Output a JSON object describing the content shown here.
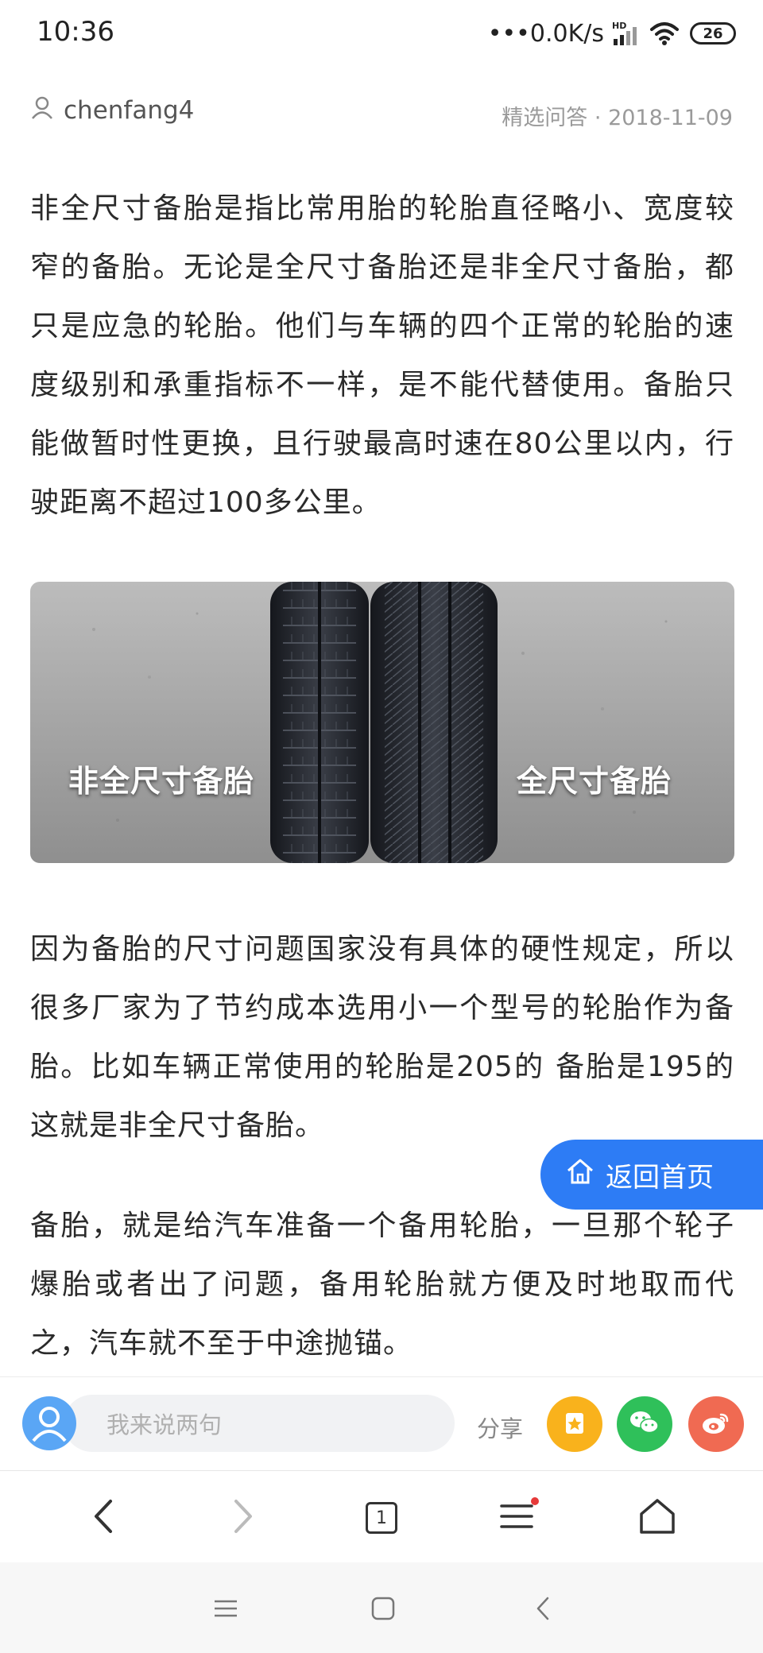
{
  "status": {
    "time": "10:36",
    "network_speed": "•••0.0K/s",
    "hd_label": "HD",
    "battery": "26"
  },
  "meta": {
    "author": "chenfang4",
    "category": "精选问答",
    "separator": "·",
    "date": "2018-11-09"
  },
  "article": {
    "p1": "非全尺寸备胎是指比常用胎的轮胎直径略小、宽度较窄的备胎。无论是全尺寸备胎还是非全尺寸备胎，都只是应急的轮胎。他们与车辆的四个正常的轮胎的速度级别和承重指标不一样，是不能代替使用。备胎只能做暂时性更换，且行驶最高时速在80公里以内，行驶距离不超过100多公里。",
    "image_label_left": "非全尺寸备胎",
    "image_label_right": "全尺寸备胎",
    "p2": "因为备胎的尺寸问题国家没有具体的硬性规定，所以很多厂家为了节约成本选用小一个型号的轮胎作为备胎。比如车辆正常使用的轮胎是205的 备胎是195的 这就是非全尺寸备胎。",
    "p3": "备胎，就是给汽车准备一个备用轮胎，一旦那个轮子爆胎或者出了问题，备用轮胎就方便及时地取而代之，汽车就不至于中途抛锚。"
  },
  "float_button": {
    "label": "返回首页"
  },
  "comment_bar": {
    "placeholder": "我来说两句",
    "share_label": "分享"
  },
  "browser_nav": {
    "tab_count": "1"
  },
  "colors": {
    "accent": "#2d7cf5",
    "qzone": "#f9b21c",
    "wechat": "#2fc05a",
    "weibo": "#f06a52"
  },
  "icons": [
    "user-icon",
    "home-icon",
    "avatar-icon",
    "qzone-icon",
    "wechat-icon",
    "weibo-icon",
    "back-icon",
    "forward-icon",
    "tabs-icon",
    "menu-icon",
    "home-nav-icon",
    "recent-apps-icon",
    "system-home-icon",
    "system-back-icon",
    "signal-icon",
    "wifi-icon",
    "battery-icon"
  ]
}
